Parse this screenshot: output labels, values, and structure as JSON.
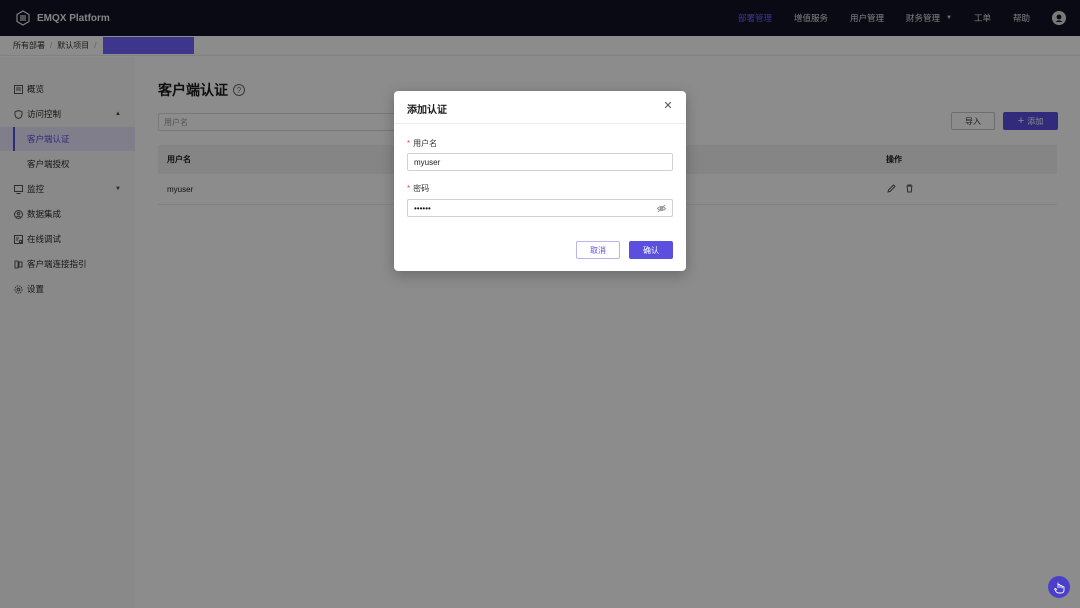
{
  "app": {
    "title": "EMQX Platform"
  },
  "nav": {
    "items": [
      {
        "label": "部署管理",
        "active": true
      },
      {
        "label": "增值服务"
      },
      {
        "label": "用户管理"
      },
      {
        "label": "财务管理",
        "dropdown": true
      },
      {
        "label": "工单"
      },
      {
        "label": "帮助"
      }
    ],
    "accent_color": "#6f63ff"
  },
  "breadcrumb": {
    "items": [
      "所有部署",
      "默认项目"
    ]
  },
  "sidebar": {
    "items": [
      {
        "label": "概览",
        "icon": "overview-icon"
      },
      {
        "label": "访问控制",
        "icon": "shield-icon",
        "expanded": true
      },
      {
        "label": "客户端认证",
        "sub": true,
        "active": true
      },
      {
        "label": "客户端授权",
        "sub": true
      },
      {
        "label": "监控",
        "icon": "monitor-icon",
        "collapsed": true
      },
      {
        "label": "数据集成",
        "icon": "integration-icon"
      },
      {
        "label": "在线调试",
        "icon": "debug-icon"
      },
      {
        "label": "客户端连接指引",
        "icon": "guide-icon"
      },
      {
        "label": "设置",
        "icon": "gear-icon"
      }
    ]
  },
  "main": {
    "title": "客户端认证",
    "search_placeholder": "用户名",
    "import_label": "导入",
    "add_label": "添加",
    "table": {
      "columns": [
        "用户名",
        "操作"
      ],
      "rows": [
        {
          "username": "myuser"
        }
      ]
    }
  },
  "dialog": {
    "title": "添加认证",
    "username_label": "用户名",
    "username_value": "myuser",
    "password_label": "密码",
    "password_value": "••••••",
    "cancel_label": "取消",
    "confirm_label": "确认"
  }
}
